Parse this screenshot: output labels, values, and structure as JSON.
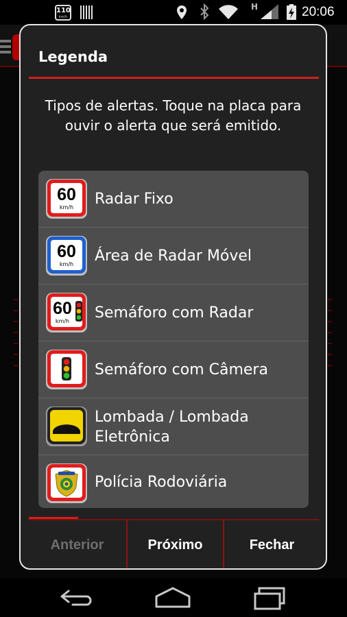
{
  "status_bar": {
    "speed_badge": "110",
    "speed_unit": "km/h",
    "network_letter": "H",
    "time": "20:06",
    "icons": [
      "speed-limit-icon",
      "barcode-icon",
      "location-icon",
      "bluetooth-icon",
      "wifi-icon",
      "signal-icon",
      "battery-charging-icon"
    ]
  },
  "dialog": {
    "title": "Legenda",
    "message": "Tipos de alertas. Toque na placa para ouvir o alerta que será emitido.",
    "items": [
      {
        "label": "Radar Fixo",
        "icon": "fixed-radar-sign-icon",
        "sign_value": "60",
        "sign_unit": "km/h"
      },
      {
        "label": "Área de Radar Móvel",
        "icon": "mobile-radar-sign-icon",
        "sign_value": "60",
        "sign_unit": "km/h"
      },
      {
        "label": "Semáforo com Radar",
        "icon": "traffic-light-radar-sign-icon",
        "sign_value": "60",
        "sign_unit": "km/h"
      },
      {
        "label": "Semáforo com Câmera",
        "icon": "traffic-light-camera-sign-icon"
      },
      {
        "label": "Lombada / Lombada Eletrônica",
        "icon": "speed-bump-sign-icon"
      },
      {
        "label": "Polícia Rodoviária",
        "icon": "highway-police-badge-icon"
      }
    ],
    "buttons": {
      "previous": "Anterior",
      "next": "Próximo",
      "close": "Fechar"
    }
  },
  "nav_bar": {
    "icons": [
      "back-icon",
      "home-icon",
      "recent-apps-icon"
    ]
  },
  "colors": {
    "accent_red": "#d21f1f",
    "dialog_bg": "#212121",
    "list_bg": "#4d4d4d",
    "sign_red": "#e11c1c",
    "sign_blue": "#1f5fcf",
    "sign_yellow": "#f1d400"
  }
}
